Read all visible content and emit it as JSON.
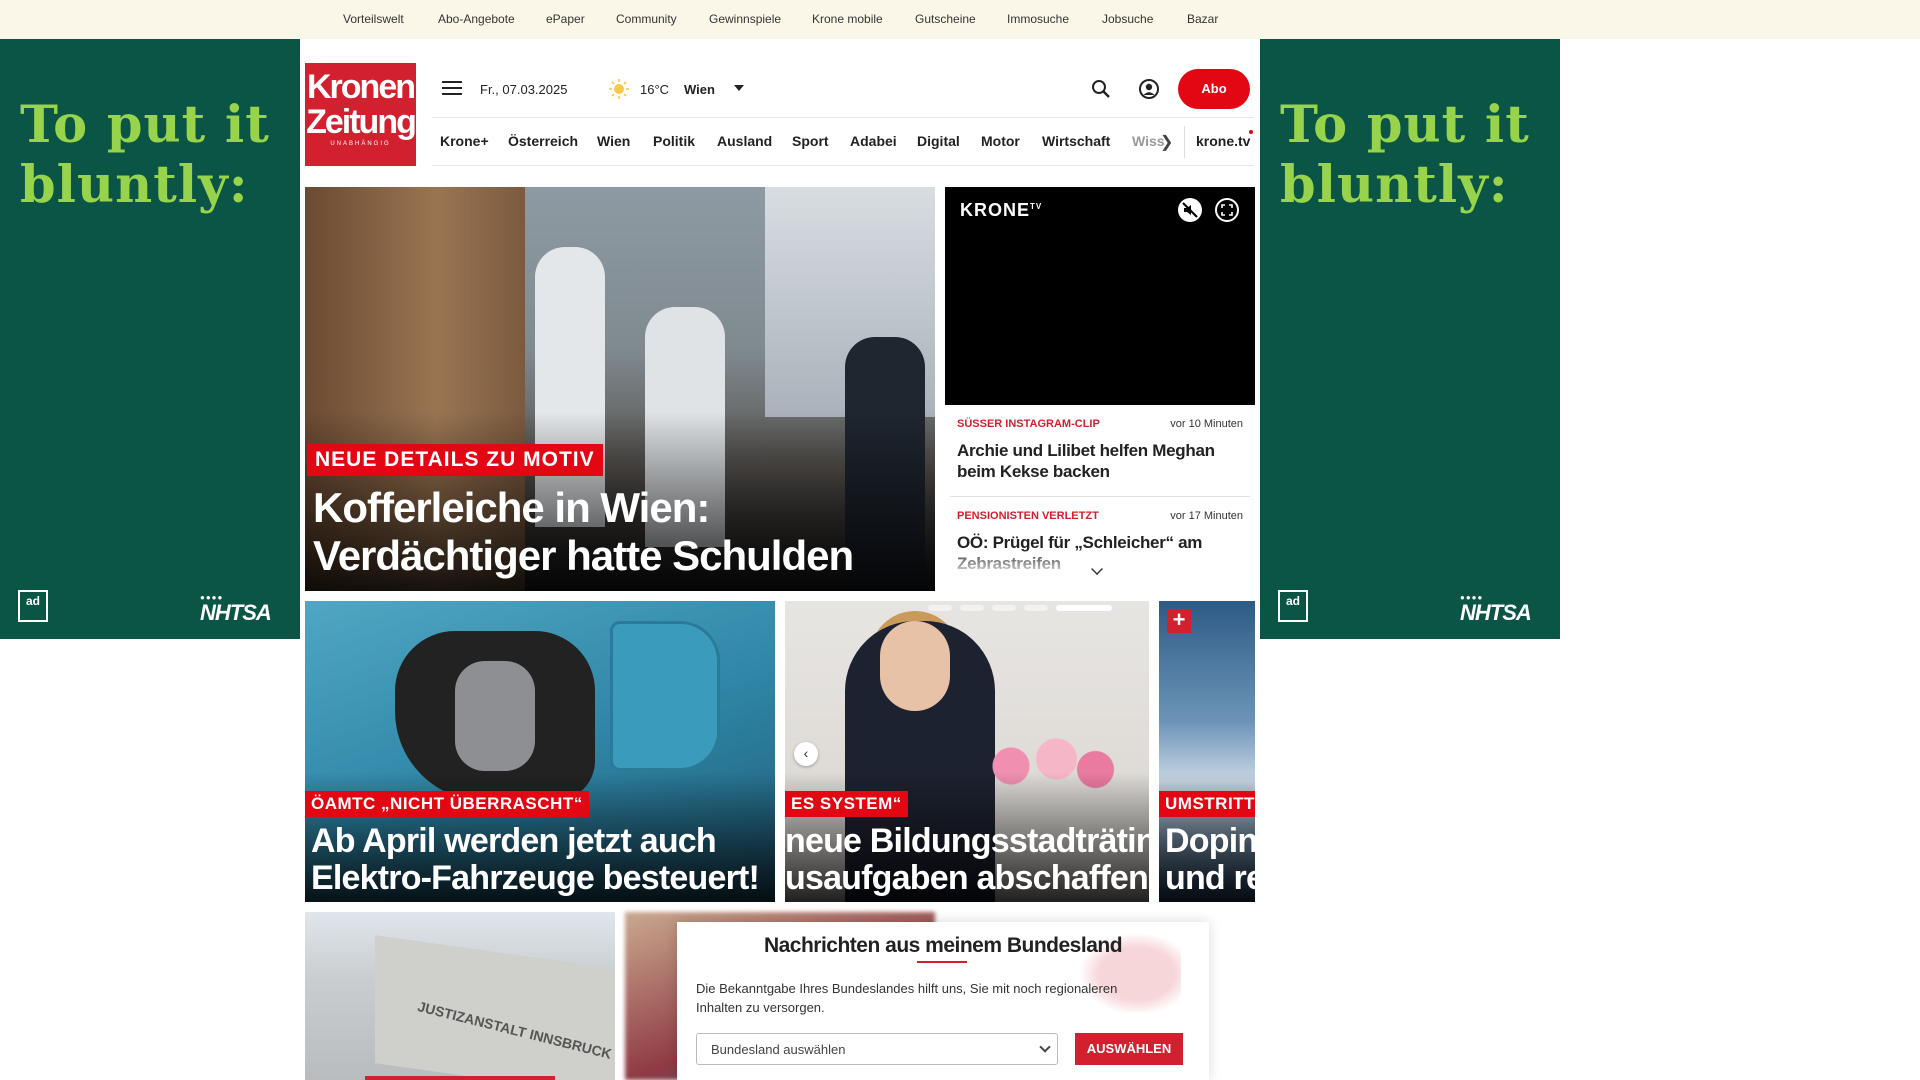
{
  "topbar": {
    "links": [
      "Vorteilswelt",
      "Abo-Angebote",
      "ePaper",
      "Community",
      "Gewinnspiele",
      "Krone mobile",
      "Gutscheine",
      "Immosuche",
      "Jobsuche",
      "Bazar"
    ]
  },
  "ads": {
    "left": {
      "text": "To put it bluntly:",
      "badge": "ad",
      "sponsor": "NHTSA"
    },
    "right": {
      "text": "To put it bluntly:",
      "badge": "ad",
      "sponsor": "NHTSA"
    },
    "colors": {
      "background": "#0a5545",
      "text": "#97d34b"
    }
  },
  "header": {
    "logo_line1": "Kronen",
    "logo_line2": "Zeitung",
    "logo_tagline": "UNABHÄNGIG",
    "date": "Fr., 07.03.2025",
    "temperature": "16°C",
    "city": "Wien",
    "abo_label": "Abo",
    "icons": [
      "menu-icon",
      "sun-icon",
      "search-icon",
      "account-icon"
    ]
  },
  "nav": {
    "items": [
      "Krone+",
      "Österreich",
      "Wien",
      "Politik",
      "Ausland",
      "Sport",
      "Adabei",
      "Digital",
      "Motor",
      "Wirtschaft",
      "Wiss"
    ],
    "tv_label": "krone.tv"
  },
  "hero": {
    "kicker": "NEUE DETAILS ZU MOTIV",
    "headline": "Kofferleiche in Wien: Verdächtiger hatte Schulden"
  },
  "video": {
    "brand": "KRONE",
    "brand_sup": "TV"
  },
  "ticker": [
    {
      "kicker": "SÜSSER INSTAGRAM-CLIP",
      "time": "vor 10 Minuten",
      "title": "Archie und Lilibet helfen Meghan beim Kekse backen"
    },
    {
      "kicker": "PENSIONISTEN VERLETZT",
      "time": "vor 17 Minuten",
      "title": "OÖ: Prügel für „Schleicher“ am Zebrastreifen"
    }
  ],
  "cards": [
    {
      "kicker": "ÖAMTC „NICHT ÜBERRASCHT“",
      "line1": "Ab April werden jetzt auch",
      "line2": "Elektro-Fahrzeuge besteuert!"
    },
    {
      "kicker": "ES SYSTEM“",
      "line1": "neue Bildungsstadträtin",
      "line2": "usaufgaben abschaffen"
    },
    {
      "kicker": "UMSTRITT",
      "line1": "Doping",
      "line2": "und re"
    }
  ],
  "prison_sign": "JUSTIZANSTALT INNSBRUCK",
  "popup": {
    "title": "Nachrichten aus meinem Bundesland",
    "text": "Die Bekanntgabe Ihres Bundeslandes hilft uns, Sie mit noch regionaleren Inhalten zu versorgen.",
    "select_placeholder": "Bundesland auswählen",
    "button": "AUSWÄHLEN"
  },
  "colors": {
    "brand_red": "#d2202f",
    "abo_red": "#e30613",
    "topbar_bg": "#fbf7e8"
  }
}
